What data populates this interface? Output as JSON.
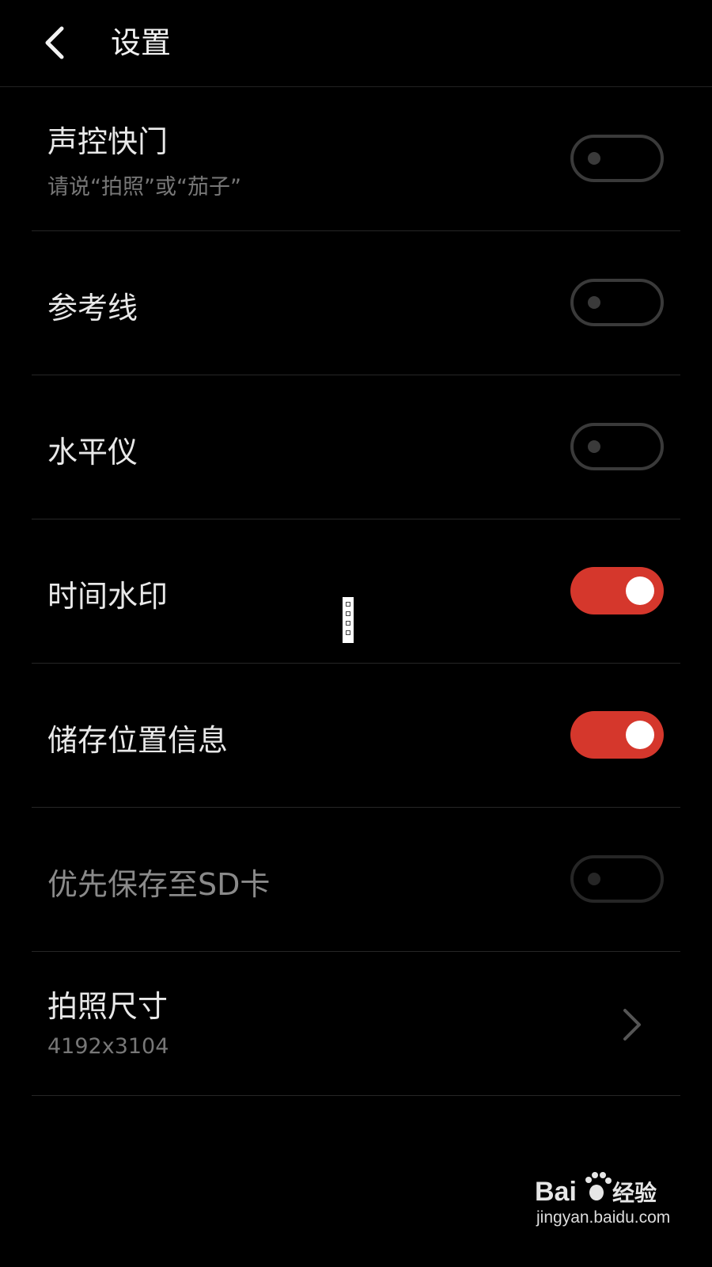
{
  "header": {
    "title": "设置"
  },
  "settings": [
    {
      "title": "声控快门",
      "subtitle": "请说“拍照”或“茄子”",
      "control": "toggle",
      "on": false
    },
    {
      "title": "参考线",
      "control": "toggle",
      "on": false
    },
    {
      "title": "水平仪",
      "control": "toggle",
      "on": false
    },
    {
      "title": "时间水印",
      "control": "toggle",
      "on": true
    },
    {
      "title": "储存位置信息",
      "control": "toggle",
      "on": true
    },
    {
      "title": "优先保存至SD卡",
      "control": "toggle",
      "on": false,
      "disabled": true
    },
    {
      "title": "拍照尺寸",
      "subtitle": "4192x3104",
      "control": "chevron"
    }
  ],
  "colors": {
    "background": "#000000",
    "accent": "#d5372c",
    "toggle_off": "#3a3a3a"
  },
  "icons": {
    "back": "chevron-left-icon",
    "navigate": "chevron-right-icon"
  },
  "watermark": {
    "logo_text": "Bai经验",
    "url": "jingyan.baidu.com"
  }
}
